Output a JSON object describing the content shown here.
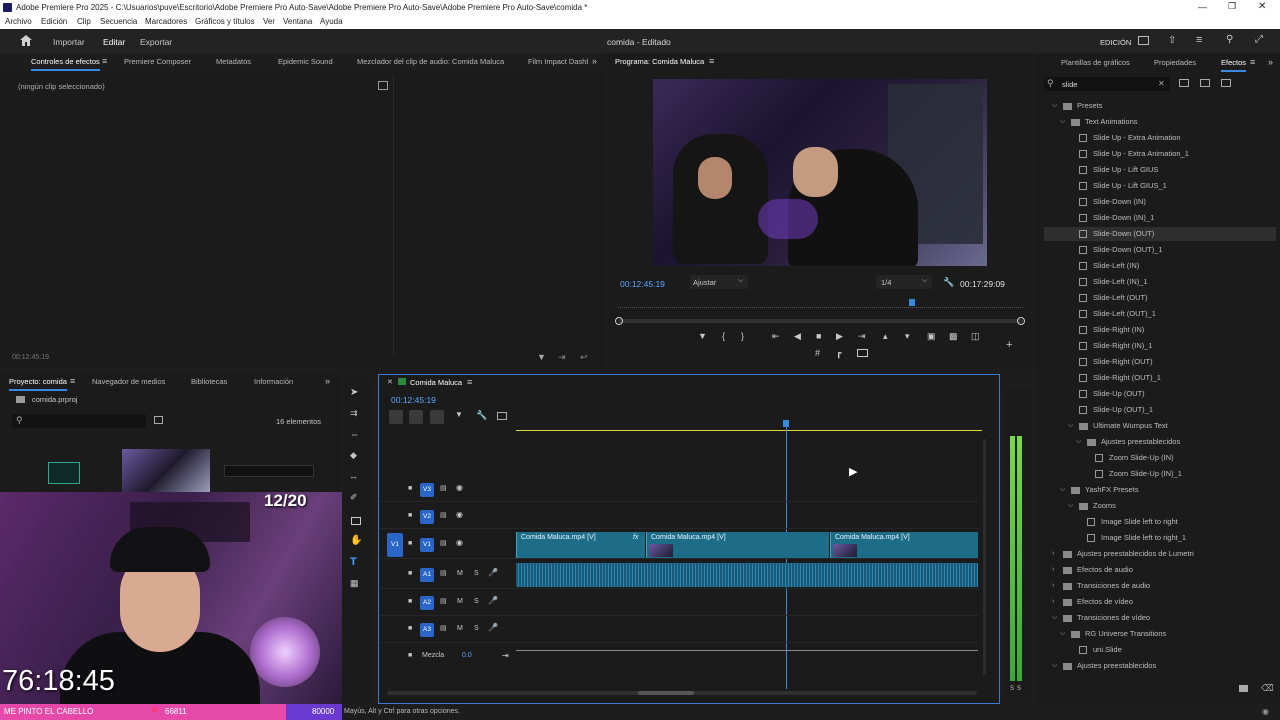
{
  "window": {
    "title": "Adobe Premiere Pro 2025 - C:\\Usuarios\\puve\\Escritorio\\Adobe Premiere Pro Auto-Save\\Adobe Premiere Pro Auto-Save\\Adobe Premiere Pro Auto-Save\\comida *"
  },
  "menu": [
    "Archivo",
    "Edición",
    "Clip",
    "Secuencia",
    "Marcadores",
    "Gráficos y títulos",
    "Ver",
    "Ventana",
    "Ayuda"
  ],
  "topbar": {
    "import": "Importar",
    "edit": "Editar",
    "export": "Exportar",
    "center": "comida - Editado",
    "workspace": "EDICIÓN"
  },
  "source_tabs": [
    "Controles de efectos",
    "Premiere Composer",
    "Metadatos",
    "Epidemic Sound",
    "Mezclador del clip de audio: Comida Maluca",
    "Film Impact Dashb"
  ],
  "effect_controls": {
    "no_clip": "(ningún clip seleccionado)",
    "timecode": "00:12:45:19"
  },
  "program": {
    "tab": "Programa: Comida Maluca",
    "timecode": "00:12:45:19",
    "fit": "Ajustar",
    "resolution": "1/4",
    "duration": "00:17:29:09",
    "playhead_fraction": 0.725
  },
  "project": {
    "tabs": [
      "Proyecto: comida",
      "Navegador de medios",
      "Bibliotecas",
      "Información"
    ],
    "file": "comida.prproj",
    "count": "16 elementos"
  },
  "timeline": {
    "tab": "Comida Maluca",
    "timecode": "00:12:45:19",
    "video_tracks": [
      "V3",
      "V2",
      "V1"
    ],
    "audio_tracks": [
      "A1",
      "A2",
      "A3"
    ],
    "source_patch": "V1",
    "mix_label": "Mezcla",
    "mix_value": "0.0",
    "clips": [
      {
        "label": "Comida Maluca.mp4 [V]"
      },
      {
        "label": "Comida Maluca.mp4 [V]"
      },
      {
        "label": "Comida Maluca.mp4 [V]"
      }
    ],
    "track_mute": "M",
    "track_solo": "S"
  },
  "effects_panel": {
    "tabs": [
      "Plantillas de gráficos",
      "Propiedades",
      "Efectos"
    ],
    "search": "slide",
    "tree": [
      {
        "label": "Presets",
        "depth": 0,
        "type": "folder",
        "open": true
      },
      {
        "label": "Text Animations",
        "depth": 1,
        "type": "folder",
        "open": true
      },
      {
        "label": "Slide Up - Extra Animation",
        "depth": 2,
        "type": "item"
      },
      {
        "label": "Slide Up - Extra Animation_1",
        "depth": 2,
        "type": "item"
      },
      {
        "label": "Slide Up - Lift GIUS",
        "depth": 2,
        "type": "item"
      },
      {
        "label": "Slide Up - Lift GIUS_1",
        "depth": 2,
        "type": "item"
      },
      {
        "label": "Slide-Down (IN)",
        "depth": 2,
        "type": "item"
      },
      {
        "label": "Slide-Down (IN)_1",
        "depth": 2,
        "type": "item"
      },
      {
        "label": "Slide-Down (OUT)",
        "depth": 2,
        "type": "item",
        "selected": true
      },
      {
        "label": "Slide-Down (OUT)_1",
        "depth": 2,
        "type": "item"
      },
      {
        "label": "Slide-Left (IN)",
        "depth": 2,
        "type": "item"
      },
      {
        "label": "Slide-Left (IN)_1",
        "depth": 2,
        "type": "item"
      },
      {
        "label": "Slide-Left (OUT)",
        "depth": 2,
        "type": "item"
      },
      {
        "label": "Slide-Left (OUT)_1",
        "depth": 2,
        "type": "item"
      },
      {
        "label": "Slide-Right (IN)",
        "depth": 2,
        "type": "item"
      },
      {
        "label": "Slide-Right (IN)_1",
        "depth": 2,
        "type": "item"
      },
      {
        "label": "Slide-Right (OUT)",
        "depth": 2,
        "type": "item"
      },
      {
        "label": "Slide-Right (OUT)_1",
        "depth": 2,
        "type": "item"
      },
      {
        "label": "Slide-Up (OUT)",
        "depth": 2,
        "type": "item"
      },
      {
        "label": "Slide-Up (OUT)_1",
        "depth": 2,
        "type": "item"
      },
      {
        "label": "Ultimate Wumpus Text",
        "depth": 2,
        "type": "folder",
        "open": true
      },
      {
        "label": "Ajustes preestablecidos",
        "depth": 3,
        "type": "folder",
        "open": true
      },
      {
        "label": "Zoom Slide-Up (IN)",
        "depth": 4,
        "type": "item"
      },
      {
        "label": "Zoom Slide-Up (IN)_1",
        "depth": 4,
        "type": "item"
      },
      {
        "label": "YashFX Presets",
        "depth": 1,
        "type": "folder",
        "open": true
      },
      {
        "label": "Zooms",
        "depth": 2,
        "type": "folder",
        "open": true
      },
      {
        "label": "Image Slide left to right",
        "depth": 3,
        "type": "item"
      },
      {
        "label": "Image Slide left to right_1",
        "depth": 3,
        "type": "item"
      },
      {
        "label": "Ajustes preestablecidos de Lumetri",
        "depth": 0,
        "type": "folder",
        "open": false
      },
      {
        "label": "Efectos de audio",
        "depth": 0,
        "type": "folder",
        "open": false
      },
      {
        "label": "Transiciones de audio",
        "depth": 0,
        "type": "folder",
        "open": false
      },
      {
        "label": "Efectos de vídeo",
        "depth": 0,
        "type": "folder",
        "open": false
      },
      {
        "label": "Transiciones de vídeo",
        "depth": 0,
        "type": "folder",
        "open": true
      },
      {
        "label": "RG Universe Transitions",
        "depth": 1,
        "type": "folder",
        "open": true
      },
      {
        "label": "uni.Slide",
        "depth": 2,
        "type": "item"
      },
      {
        "label": "Ajustes preestablecidos",
        "depth": 0,
        "type": "folder",
        "open": true
      }
    ]
  },
  "meter_labels": [
    "S",
    "S"
  ],
  "stream_overlay": {
    "counter": "12/20",
    "timer": "76:18:45",
    "banner_text": "ME PINTO EL CABELLO",
    "banner_count": "66811",
    "banner_goal": "80000"
  },
  "status_bar": "Mayús, Alt y Ctrl para otras opciones."
}
